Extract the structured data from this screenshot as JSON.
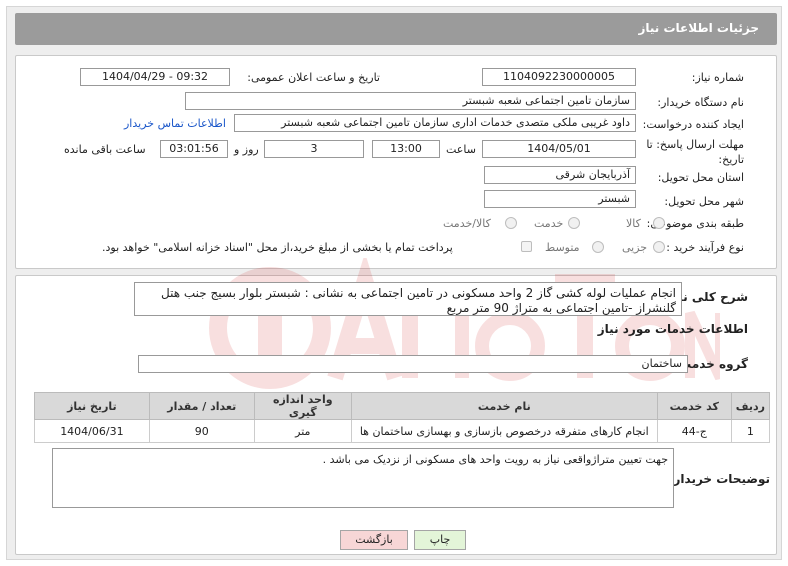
{
  "header": {
    "title": "جزئیات اطلاعات نیاز"
  },
  "fields": {
    "need_number_label": "شماره نیاز:",
    "need_number": "1104092230000005",
    "announce_label": "تاریخ و ساعت اعلان عمومی:",
    "announce_value": "1404/04/29 - 09:32",
    "buyer_org_label": "نام دستگاه خریدار:",
    "buyer_org": "سازمان تامین اجتماعی شعبه شبستر",
    "creator_label": "ایجاد کننده درخواست:",
    "creator": "داود غریبی ملکی متصدی خدمات اداری سازمان تامین اجتماعی شعبه شبستر",
    "contact_link": "اطلاعات تماس خریدار",
    "deadline_label": "مهلت ارسال پاسخ: تا تاریخ:",
    "deadline_date": "1404/05/01",
    "time_label": "ساعت",
    "deadline_time": "13:00",
    "days": "3",
    "days_label": "روز و",
    "remaining_time": "03:01:56",
    "remaining_label": "ساعت باقی مانده",
    "province_label": "استان محل تحویل:",
    "province": "آذربایجان شرقی",
    "city_label": "شهر محل تحویل:",
    "city": "شبستر",
    "category_label": "طبقه بندی موضوعی:",
    "category_options": [
      "کالا",
      "خدمت",
      "کالا/خدمت"
    ],
    "process_label": "نوع فرآیند خرید :",
    "process_options": [
      "جزیی",
      "متوسط"
    ],
    "payment_note": "پرداخت تمام یا بخشی از مبلغ خرید،از محل \"اسناد خزانه اسلامی\" خواهد بود."
  },
  "description": {
    "label": "شرح کلی نیاز:",
    "text": "انجام عملیات لوله کشی گاز 2 واحد مسکونی در تامین اجتماعی به نشانی : شبستر بلوار بسیج جنب هتل گلنشراز -تامین اجتماعی  به متراژ 90 متر مربع"
  },
  "services": {
    "section_title": "اطلاعات خدمات مورد نیاز",
    "group_label": "گروه خدمت:",
    "group_value": "ساختمان",
    "columns": [
      "ردیف",
      "کد خدمت",
      "نام خدمت",
      "واحد اندازه گیری",
      "تعداد / مقدار",
      "تاریخ نیاز"
    ],
    "rows": [
      {
        "index": "1",
        "code": "ج-44",
        "name": "انجام کارهای متفرقه درخصوص بازسازی و بهسازی ساختمان ها",
        "unit": "متر",
        "qty": "90",
        "date": "1404/06/31"
      }
    ]
  },
  "buyer_notes": {
    "label": "توضیحات خریدار:",
    "text": "جهت تعیین متراژواقعی نیاز به رویت واحد های مسکونی از نزدیک می باشد ."
  },
  "buttons": {
    "print": "چاپ",
    "back": "بازگشت"
  },
  "colors": {
    "title_bg": "#9b9b9b",
    "link": "#1a56c9",
    "back_btn": "#f7d6d6",
    "print_btn": "#e3f5d8"
  }
}
